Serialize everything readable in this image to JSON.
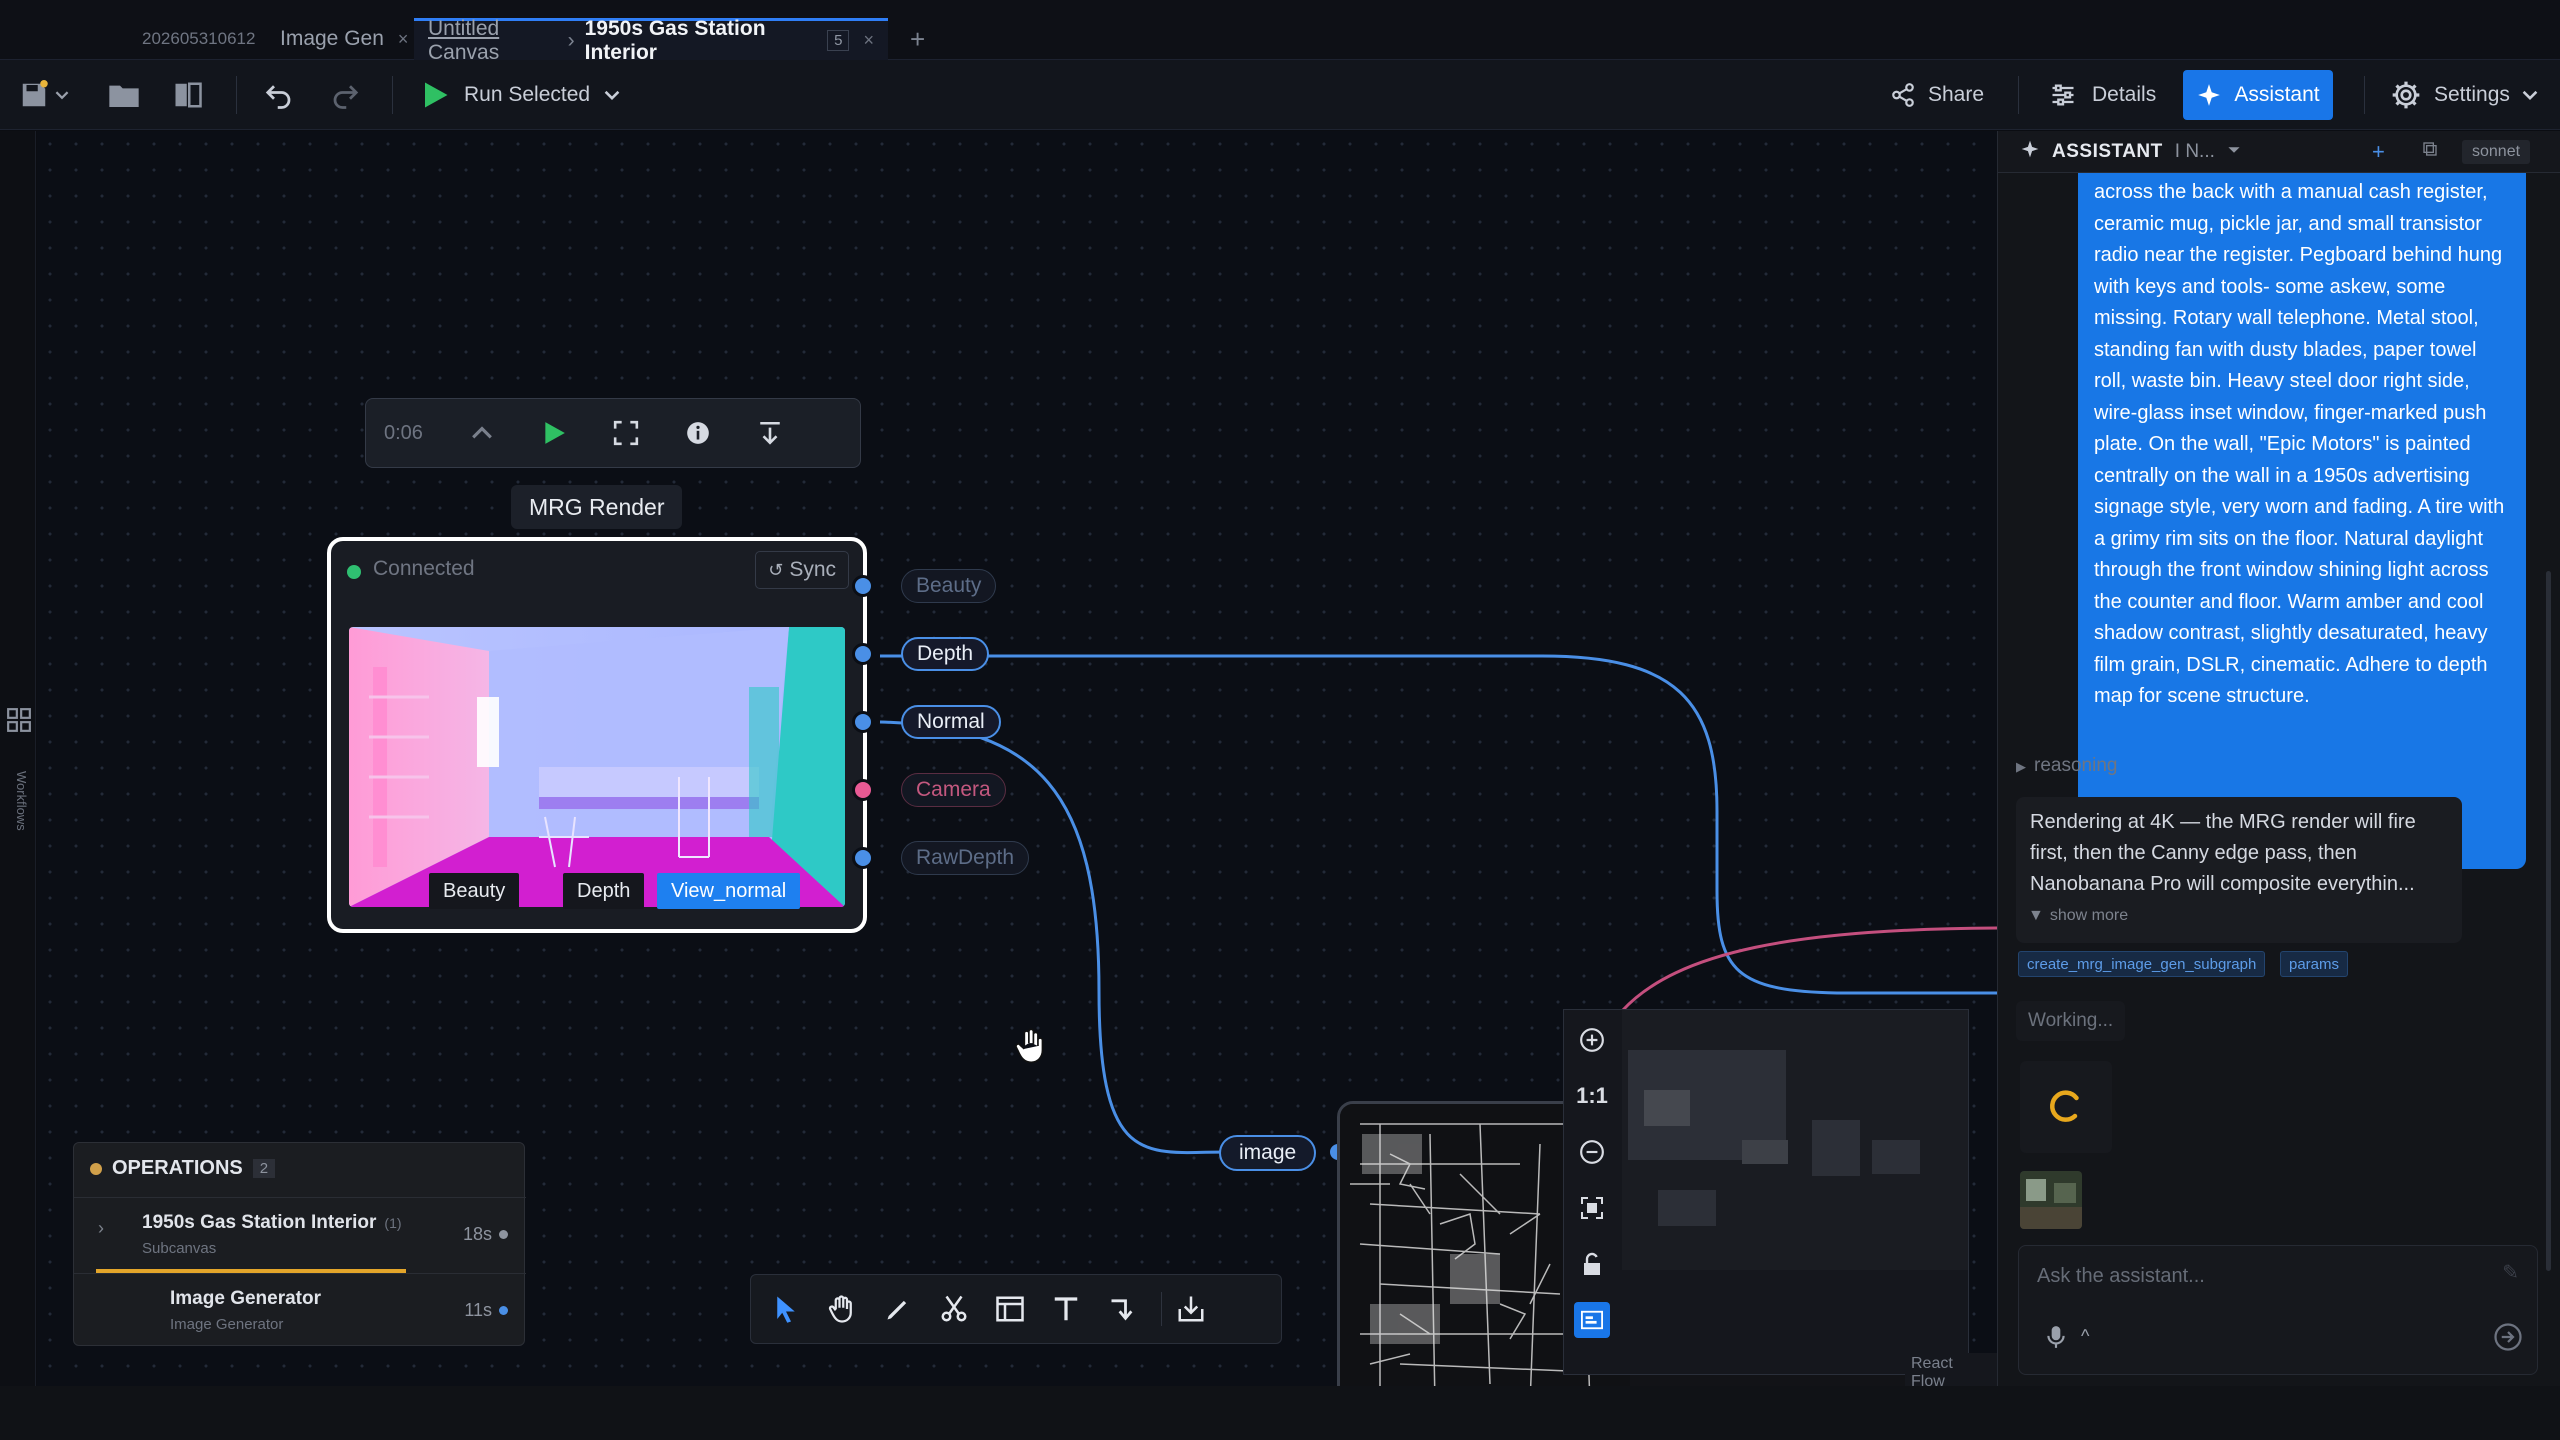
{
  "tabs": {
    "date_label": "202605310612",
    "image_gen": "Image Gen",
    "canvas_crumb1": "Untitled Canvas",
    "canvas_sep": "›",
    "canvas_crumb2": "1950s Gas Station Interior",
    "canvas_count": "5",
    "close_glyph": "×",
    "add_glyph": "+"
  },
  "toolbar": {
    "run_label": "Run Selected",
    "share_label": "Share",
    "details_label": "Details",
    "assistant_label": "Assistant",
    "settings_label": "Settings"
  },
  "rail": {
    "workflows_label": "Workflows"
  },
  "player": {
    "time": "0:06"
  },
  "mrg_node": {
    "title": "MRG Render",
    "status": "Connected",
    "sync_label": "Sync",
    "pass_tabs": [
      "Beauty",
      "Depth",
      "View_normal"
    ],
    "active_pass": "View_normal",
    "outputs": [
      "Beauty",
      "Depth",
      "Normal",
      "Camera",
      "RawDepth"
    ]
  },
  "image_input_label": "image",
  "minimap": {
    "one_to_one": "1:1",
    "attribution": "React Flow"
  },
  "operations": {
    "title": "OPERATIONS",
    "count": "2",
    "items": [
      {
        "name": "1950s Gas Station Interior",
        "count": "(1)",
        "sub": "Subcanvas",
        "time": "18s",
        "status_color": "#8e949f"
      },
      {
        "name": "Image Generator",
        "sub": "Image Generator",
        "time": "11s",
        "status_color": "#4a8fe6"
      }
    ]
  },
  "assistant": {
    "title": "ASSISTANT",
    "conversation": "I N...",
    "model": "sonnet",
    "user_message": "across the back with a manual cash register, ceramic mug, pickle jar, and small transistor radio near the register. Pegboard behind hung with keys and tools- some askew, some missing. Rotary wall telephone. Metal stool, standing fan with dusty blades, paper towel roll, waste bin. Heavy steel door right side, wire-glass inset window, finger-marked push plate. On the wall, \"Epic Motors\" is painted centrally on the wall in a 1950s advertising signage style, very worn and fading. A tire with a grimy rim sits on the floor. Natural daylight through the front window shining light across the counter and floor. Warm amber and cool shadow contrast, slightly desaturated, heavy film grain, DSLR, cinematic. Adhere to depth map for scene structure.",
    "reasoning_label": "reasoning",
    "reply": "Rendering at 4K — the MRG render will fire first, then the Canny edge pass, then Nanobanana Pro will composite everythin...",
    "show_more": "show more",
    "tool_chips": [
      "create_mrg_image_gen_subgraph",
      "params"
    ],
    "working": "Working...",
    "input_placeholder": "Ask the assistant..."
  },
  "colors": {
    "accent": "#1976e8",
    "wire_blue": "#4a8fe6",
    "wire_pink": "#c44f7e",
    "connected": "#2fbf71",
    "progress": "#e3a52a"
  }
}
